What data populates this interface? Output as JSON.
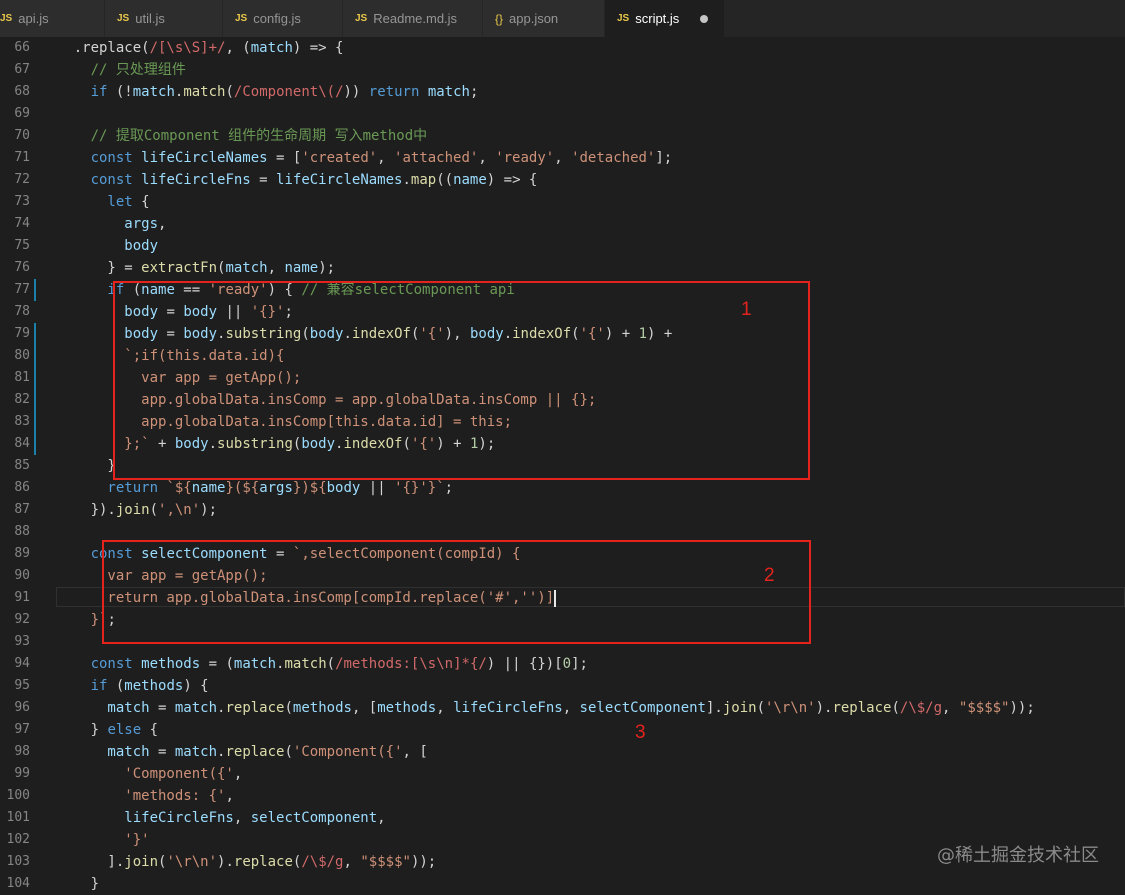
{
  "tabs": [
    {
      "icon": "JS",
      "label": "api.js",
      "active": false
    },
    {
      "icon": "JS",
      "label": "util.js",
      "active": false
    },
    {
      "icon": "JS",
      "label": "config.js",
      "active": false
    },
    {
      "icon": "JS",
      "label": "Readme.md.js",
      "active": false
    },
    {
      "icon": "{}",
      "label": "app.json",
      "active": false
    },
    {
      "icon": "JS",
      "label": "script.js",
      "active": true
    }
  ],
  "code_lines": [
    {
      "n": 66,
      "t": [
        [
          "p",
          "    .replace("
        ],
        [
          "r",
          "/[\\s\\S]+/"
        ],
        [
          "p",
          ", ("
        ],
        [
          "v",
          "match"
        ],
        [
          "p",
          ") => {"
        ]
      ]
    },
    {
      "n": 67,
      "t": [
        [
          "c",
          "      // 只处理组件"
        ]
      ]
    },
    {
      "n": 68,
      "t": [
        [
          "k",
          "      if"
        ],
        [
          "p",
          " (!"
        ],
        [
          "v",
          "match"
        ],
        [
          "p",
          "."
        ],
        [
          "f",
          "match"
        ],
        [
          "p",
          "("
        ],
        [
          "r",
          "/Component\\(/"
        ],
        [
          "p",
          ")) "
        ],
        [
          "k",
          "return"
        ],
        [
          "p",
          " "
        ],
        [
          "v",
          "match"
        ],
        [
          "p",
          ";"
        ]
      ]
    },
    {
      "n": 69,
      "t": []
    },
    {
      "n": 70,
      "t": [
        [
          "c",
          "      // 提取Component 组件的生命周期 写入method中"
        ]
      ]
    },
    {
      "n": 71,
      "t": [
        [
          "k",
          "      const"
        ],
        [
          "p",
          " "
        ],
        [
          "v",
          "lifeCircleNames"
        ],
        [
          "p",
          " = ["
        ],
        [
          "s",
          "'created'"
        ],
        [
          "p",
          ", "
        ],
        [
          "s",
          "'attached'"
        ],
        [
          "p",
          ", "
        ],
        [
          "s",
          "'ready'"
        ],
        [
          "p",
          ", "
        ],
        [
          "s",
          "'detached'"
        ],
        [
          "p",
          "];"
        ]
      ]
    },
    {
      "n": 72,
      "t": [
        [
          "k",
          "      const"
        ],
        [
          "p",
          " "
        ],
        [
          "v",
          "lifeCircleFns"
        ],
        [
          "p",
          " = "
        ],
        [
          "v",
          "lifeCircleNames"
        ],
        [
          "p",
          "."
        ],
        [
          "f",
          "map"
        ],
        [
          "p",
          "(("
        ],
        [
          "v",
          "name"
        ],
        [
          "p",
          ") => {"
        ]
      ]
    },
    {
      "n": 73,
      "t": [
        [
          "k",
          "        let"
        ],
        [
          "p",
          " {"
        ]
      ]
    },
    {
      "n": 74,
      "t": [
        [
          "v",
          "          args"
        ],
        [
          "p",
          ","
        ]
      ]
    },
    {
      "n": 75,
      "t": [
        [
          "v",
          "          body"
        ]
      ]
    },
    {
      "n": 76,
      "t": [
        [
          "p",
          "        } = "
        ],
        [
          "f",
          "extractFn"
        ],
        [
          "p",
          "("
        ],
        [
          "v",
          "match"
        ],
        [
          "p",
          ", "
        ],
        [
          "v",
          "name"
        ],
        [
          "p",
          ");"
        ]
      ]
    },
    {
      "n": 77,
      "t": [
        [
          "k",
          "        if"
        ],
        [
          "p",
          " ("
        ],
        [
          "v",
          "name"
        ],
        [
          "p",
          " == "
        ],
        [
          "s",
          "'ready'"
        ],
        [
          "p",
          ") { "
        ],
        [
          "c",
          "// 兼容selectComponent api"
        ]
      ]
    },
    {
      "n": 78,
      "t": [
        [
          "v",
          "          body"
        ],
        [
          "p",
          " = "
        ],
        [
          "v",
          "body"
        ],
        [
          "p",
          " || "
        ],
        [
          "s",
          "'{}'"
        ],
        [
          "p",
          ";"
        ]
      ]
    },
    {
      "n": 79,
      "t": [
        [
          "v",
          "          body"
        ],
        [
          "p",
          " = "
        ],
        [
          "v",
          "body"
        ],
        [
          "p",
          "."
        ],
        [
          "f",
          "substring"
        ],
        [
          "p",
          "("
        ],
        [
          "v",
          "body"
        ],
        [
          "p",
          "."
        ],
        [
          "f",
          "indexOf"
        ],
        [
          "p",
          "("
        ],
        [
          "s",
          "'{'"
        ],
        [
          "p",
          "), "
        ],
        [
          "v",
          "body"
        ],
        [
          "p",
          "."
        ],
        [
          "f",
          "indexOf"
        ],
        [
          "p",
          "("
        ],
        [
          "s",
          "'{'"
        ],
        [
          "p",
          ") + "
        ],
        [
          "n",
          "1"
        ],
        [
          "p",
          ") +"
        ]
      ]
    },
    {
      "n": 80,
      "t": [
        [
          "s",
          "          `;if(this.data.id){"
        ]
      ]
    },
    {
      "n": 81,
      "t": [
        [
          "s",
          "            var app = getApp();"
        ]
      ]
    },
    {
      "n": 82,
      "t": [
        [
          "s",
          "            app.globalData.insComp = app.globalData.insComp || {};"
        ]
      ]
    },
    {
      "n": 83,
      "t": [
        [
          "s",
          "            app.globalData.insComp[this.data.id] = this;"
        ]
      ]
    },
    {
      "n": 84,
      "t": [
        [
          "s",
          "          };`"
        ],
        [
          "p",
          " + "
        ],
        [
          "v",
          "body"
        ],
        [
          "p",
          "."
        ],
        [
          "f",
          "substring"
        ],
        [
          "p",
          "("
        ],
        [
          "v",
          "body"
        ],
        [
          "p",
          "."
        ],
        [
          "f",
          "indexOf"
        ],
        [
          "p",
          "("
        ],
        [
          "s",
          "'{'"
        ],
        [
          "p",
          ") + "
        ],
        [
          "n",
          "1"
        ],
        [
          "p",
          ");"
        ]
      ]
    },
    {
      "n": 85,
      "t": [
        [
          "p",
          "        }"
        ]
      ]
    },
    {
      "n": 86,
      "t": [
        [
          "k",
          "        return"
        ],
        [
          "p",
          " "
        ],
        [
          "s",
          "`${"
        ],
        [
          "v",
          "name"
        ],
        [
          "s",
          "}(${"
        ],
        [
          "v",
          "args"
        ],
        [
          "s",
          "})${"
        ],
        [
          "v",
          "body"
        ],
        [
          "p",
          " || "
        ],
        [
          "s",
          "'{}'"
        ],
        [
          "s",
          "}`"
        ],
        [
          "p",
          ";"
        ]
      ]
    },
    {
      "n": 87,
      "t": [
        [
          "p",
          "      })."
        ],
        [
          "f",
          "join"
        ],
        [
          "p",
          "("
        ],
        [
          "s",
          "',\\n'"
        ],
        [
          "p",
          ");"
        ]
      ]
    },
    {
      "n": 88,
      "t": []
    },
    {
      "n": 89,
      "t": [
        [
          "k",
          "      const"
        ],
        [
          "p",
          " "
        ],
        [
          "v",
          "selectComponent"
        ],
        [
          "p",
          " = "
        ],
        [
          "s",
          "`,selectComponent(compId) {"
        ]
      ]
    },
    {
      "n": 90,
      "t": [
        [
          "s",
          "        var app = getApp();"
        ]
      ]
    },
    {
      "n": 91,
      "t": [
        [
          "s",
          "        return app.globalData.insComp[compId.replace('#','')]"
        ]
      ],
      "cursor": true
    },
    {
      "n": 92,
      "t": [
        [
          "s",
          "      }`"
        ],
        [
          "p",
          ";"
        ]
      ]
    },
    {
      "n": 93,
      "t": []
    },
    {
      "n": 94,
      "t": [
        [
          "k",
          "      const"
        ],
        [
          "p",
          " "
        ],
        [
          "v",
          "methods"
        ],
        [
          "p",
          " = ("
        ],
        [
          "v",
          "match"
        ],
        [
          "p",
          "."
        ],
        [
          "f",
          "match"
        ],
        [
          "p",
          "("
        ],
        [
          "r",
          "/methods:[\\s\\n]*{/"
        ],
        [
          "p",
          ") || {})["
        ],
        [
          "n",
          "0"
        ],
        [
          "p",
          "];"
        ]
      ]
    },
    {
      "n": 95,
      "t": [
        [
          "k",
          "      if"
        ],
        [
          "p",
          " ("
        ],
        [
          "v",
          "methods"
        ],
        [
          "p",
          ") {"
        ]
      ]
    },
    {
      "n": 96,
      "t": [
        [
          "v",
          "        match"
        ],
        [
          "p",
          " = "
        ],
        [
          "v",
          "match"
        ],
        [
          "p",
          "."
        ],
        [
          "f",
          "replace"
        ],
        [
          "p",
          "("
        ],
        [
          "v",
          "methods"
        ],
        [
          "p",
          ", ["
        ],
        [
          "v",
          "methods"
        ],
        [
          "p",
          ", "
        ],
        [
          "v",
          "lifeCircleFns"
        ],
        [
          "p",
          ", "
        ],
        [
          "v",
          "selectComponent"
        ],
        [
          "p",
          "]."
        ],
        [
          "f",
          "join"
        ],
        [
          "p",
          "("
        ],
        [
          "s",
          "'\\r\\n'"
        ],
        [
          "p",
          ")."
        ],
        [
          "f",
          "replace"
        ],
        [
          "p",
          "("
        ],
        [
          "r",
          "/\\$/g"
        ],
        [
          "p",
          ", "
        ],
        [
          "s",
          "\"$$$$\""
        ],
        [
          "p",
          "));"
        ]
      ]
    },
    {
      "n": 97,
      "t": [
        [
          "p",
          "      } "
        ],
        [
          "k",
          "else"
        ],
        [
          "p",
          " {"
        ]
      ]
    },
    {
      "n": 98,
      "t": [
        [
          "v",
          "        match"
        ],
        [
          "p",
          " = "
        ],
        [
          "v",
          "match"
        ],
        [
          "p",
          "."
        ],
        [
          "f",
          "replace"
        ],
        [
          "p",
          "("
        ],
        [
          "s",
          "'Component({'"
        ],
        [
          "p",
          ", ["
        ]
      ]
    },
    {
      "n": 99,
      "t": [
        [
          "s",
          "          'Component({'"
        ],
        [
          "p",
          ","
        ]
      ]
    },
    {
      "n": 100,
      "t": [
        [
          "s",
          "          'methods: {'"
        ],
        [
          "p",
          ","
        ]
      ]
    },
    {
      "n": 101,
      "t": [
        [
          "v",
          "          lifeCircleFns"
        ],
        [
          "p",
          ", "
        ],
        [
          "v",
          "selectComponent"
        ],
        [
          "p",
          ","
        ]
      ]
    },
    {
      "n": 102,
      "t": [
        [
          "s",
          "          '}'"
        ]
      ]
    },
    {
      "n": 103,
      "t": [
        [
          "p",
          "        ]."
        ],
        [
          "f",
          "join"
        ],
        [
          "p",
          "("
        ],
        [
          "s",
          "'\\r\\n'"
        ],
        [
          "p",
          ")."
        ],
        [
          "f",
          "replace"
        ],
        [
          "p",
          "("
        ],
        [
          "r",
          "/\\$/g"
        ],
        [
          "p",
          ", "
        ],
        [
          "s",
          "\"$$$$\""
        ],
        [
          "p",
          "));"
        ]
      ]
    },
    {
      "n": 104,
      "t": [
        [
          "p",
          "      }"
        ]
      ]
    }
  ],
  "annotations": [
    "1",
    "2",
    "3"
  ],
  "watermark": "@稀土掘金技术社区",
  "colors": {
    "annotation": "#e5231d",
    "background": "#1e1e1e",
    "keyword": "#569cd6",
    "string": "#ce9178",
    "comment": "#6a9955"
  }
}
